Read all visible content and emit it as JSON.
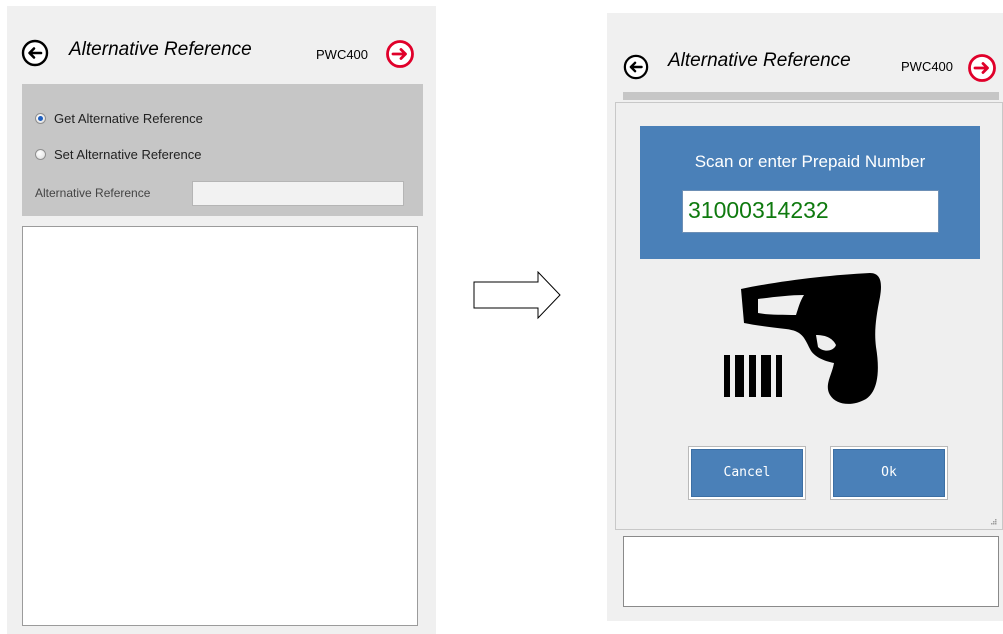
{
  "left_screen": {
    "title": "Alternative Reference",
    "code": "PWC400",
    "options": [
      {
        "label": "Get Alternative Reference",
        "checked": true
      },
      {
        "label": "Set Alternative Reference",
        "checked": false
      }
    ],
    "alt_reference_label": "Alternative Reference",
    "alt_reference_value": ""
  },
  "right_screen": {
    "title": "Alternative Reference",
    "code": "PWC400",
    "dialog": {
      "prompt": "Scan or enter Prepaid Number",
      "prepaid_number": "31000314232",
      "cancel_label": "Cancel",
      "ok_label": "Ok"
    }
  },
  "icons": {
    "back": "back-arrow-circle-icon",
    "forward": "forward-arrow-circle-icon",
    "transition": "right-arrow-outline",
    "scanner": "barcode-scanner-icon"
  },
  "colors": {
    "forward_icon": "#e0002a",
    "dialog_blue": "#4a80b8",
    "prepaid_text": "#0f7a0f",
    "panel_bg": "#f0f0f0",
    "options_bg": "#c6c6c6"
  }
}
